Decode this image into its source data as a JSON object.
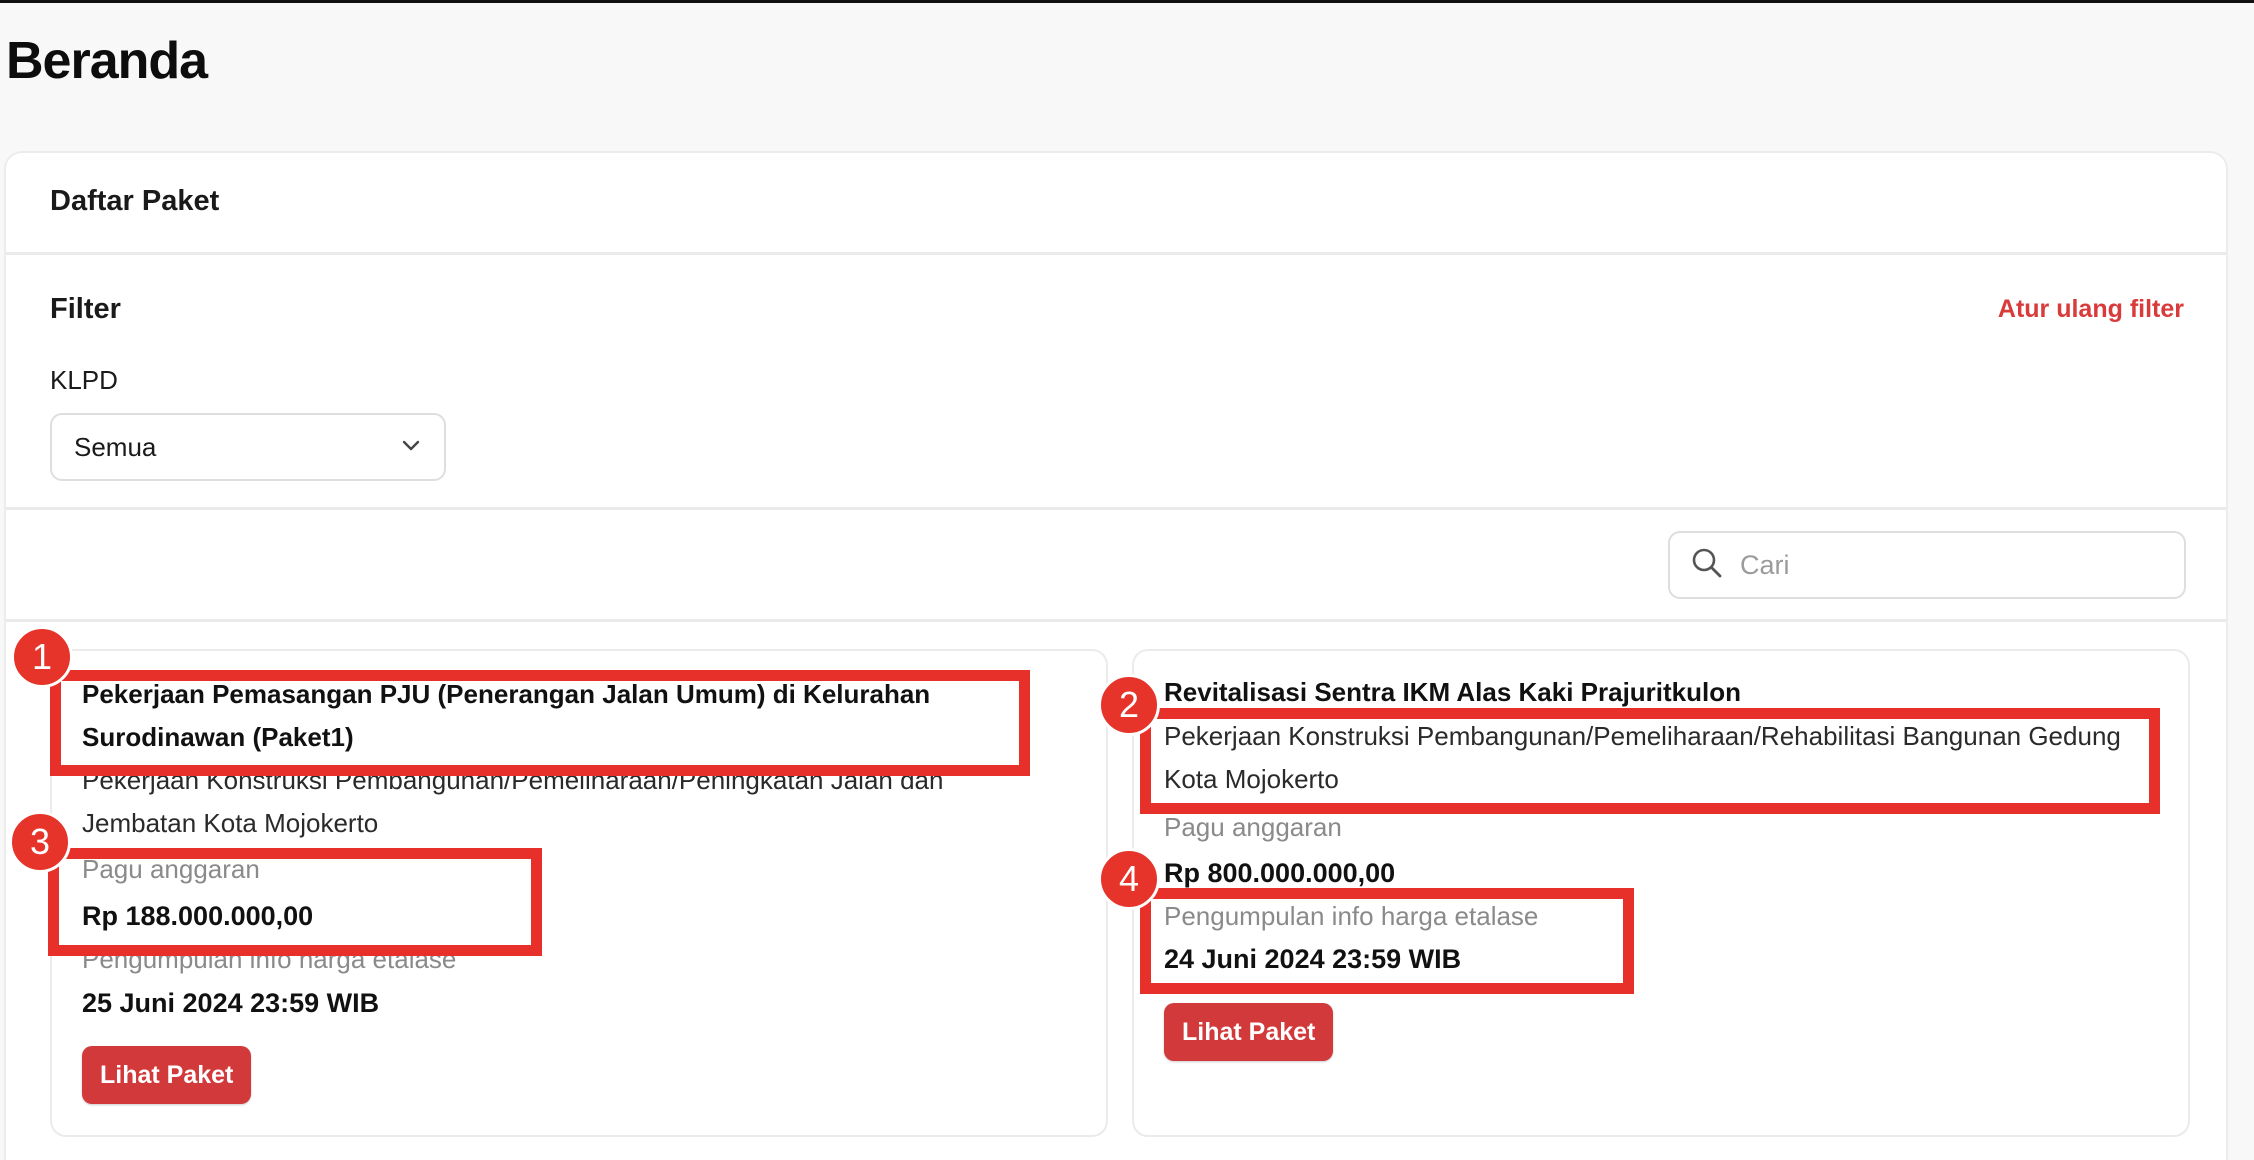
{
  "page": {
    "title": "Beranda"
  },
  "panel": {
    "title": "Daftar Paket",
    "filter_title": "Filter",
    "reset_label": "Atur ulang filter",
    "klpd_label": "KLPD",
    "klpd_value": "Semua",
    "search_placeholder": "Cari"
  },
  "cards": [
    {
      "title": "Pekerjaan Pemasangan PJU (Penerangan Jalan Umum) di Kelurahan Surodinawan (Paket1)",
      "category": "Pekerjaan Konstruksi Pembangunan/Pemeliharaan/Peningkatan Jalan dan Jembatan Kota Mojokerto",
      "budget_label": "Pagu anggaran",
      "budget_value": "Rp 188.000.000,00",
      "deadline_label": "Pengumpulan info harga etalase",
      "deadline_value": "25 Juni 2024 23:59 WIB",
      "button_label": "Lihat Paket"
    },
    {
      "title": "Revitalisasi Sentra IKM Alas Kaki Prajuritkulon",
      "category": "Pekerjaan Konstruksi Pembangunan/Pemeliharaan/Rehabilitasi Bangunan Gedung Kota Mojokerto",
      "budget_label": "Pagu anggaran",
      "budget_value": "Rp 800.000.000,00",
      "deadline_label": "Pengumpulan info harga etalase",
      "deadline_value": "24 Juni 2024 23:59 WIB",
      "button_label": "Lihat Paket"
    }
  ],
  "annotations": {
    "labels": [
      "1",
      "2",
      "3",
      "4"
    ],
    "color": "#e8302a"
  },
  "colors": {
    "accent": "#d2393a",
    "background": "#f8f8f8"
  }
}
